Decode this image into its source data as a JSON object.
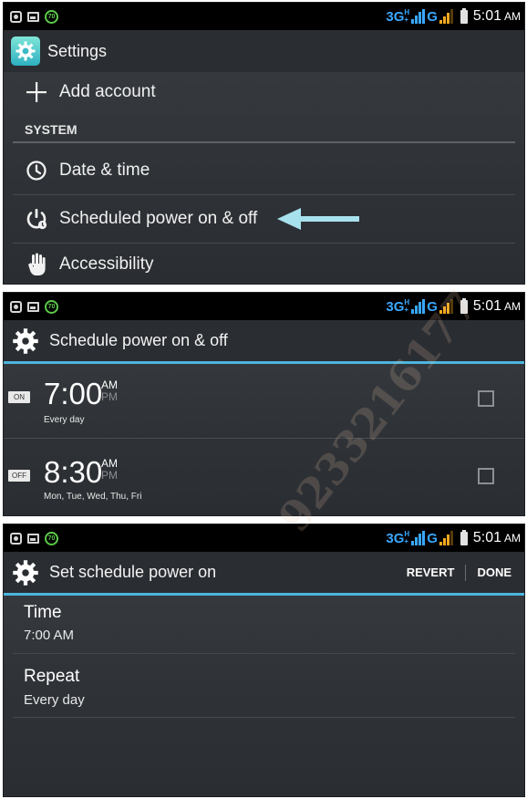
{
  "status_bar": {
    "network_3g": "3G",
    "signal_hplus": [
      "H",
      "+"
    ],
    "network_g": "G",
    "time": "5:01",
    "ampm": "AM",
    "notification_badge": "70",
    "accent_color": "#39a7ff"
  },
  "settings_screen": {
    "title": "Settings",
    "add_account": "Add account",
    "section_system": "SYSTEM",
    "date_time": "Date & time",
    "scheduled_power": "Scheduled power on & off",
    "accessibility": "Accessibility",
    "pointer_arrow_color": "#a8e1ee"
  },
  "schedule_screen": {
    "title": "Schedule power on & off",
    "alarms": [
      {
        "toggle": "ON",
        "time": "7:00",
        "am": "AM",
        "pm": "PM",
        "days": "Every day",
        "checked": false
      },
      {
        "toggle": "OFF",
        "time": "8:30",
        "am": "AM",
        "pm": "PM",
        "days": "Mon, Tue, Wed, Thu, Fri",
        "checked": false
      }
    ]
  },
  "set_schedule_screen": {
    "title": "Set schedule power on",
    "revert_label": "REVERT",
    "done_label": "DONE",
    "time_label": "Time",
    "time_value": "7:00 AM",
    "repeat_label": "Repeat",
    "repeat_value": "Every day"
  },
  "watermark": "9233216177",
  "colors": {
    "accent_blue": "#4cb6de",
    "background": "#2f3337",
    "status_bar": "#000000"
  }
}
